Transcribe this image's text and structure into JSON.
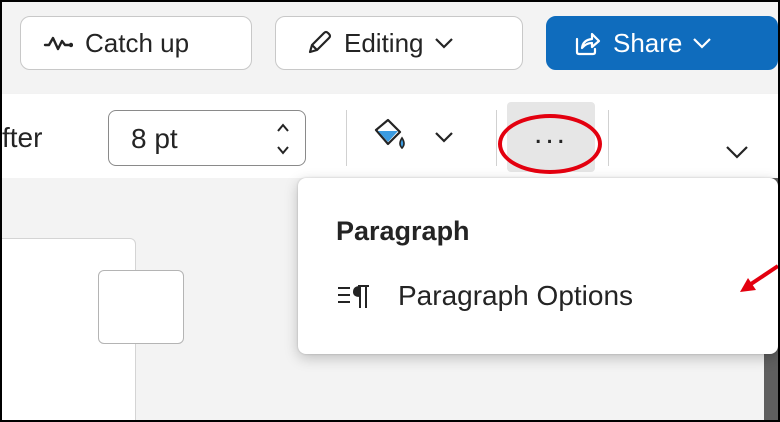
{
  "topbar": {
    "catch_up": {
      "label": "Catch up",
      "icon": "pulse-icon"
    },
    "editing": {
      "label": "Editing",
      "icon": "pen-icon"
    },
    "share": {
      "label": "Share",
      "icon": "share-icon"
    }
  },
  "ribbon": {
    "spacing_label": "fter",
    "spacing_value": "8 pt",
    "more_label": "..."
  },
  "menu": {
    "title": "Paragraph",
    "items": [
      {
        "label": "Paragraph Options",
        "icon": "paragraph-options-icon"
      }
    ]
  },
  "colors": {
    "share_bg": "#0f6cbd",
    "highlight_ring": "#e3000f",
    "annotation_arrow": "#e3000f"
  }
}
